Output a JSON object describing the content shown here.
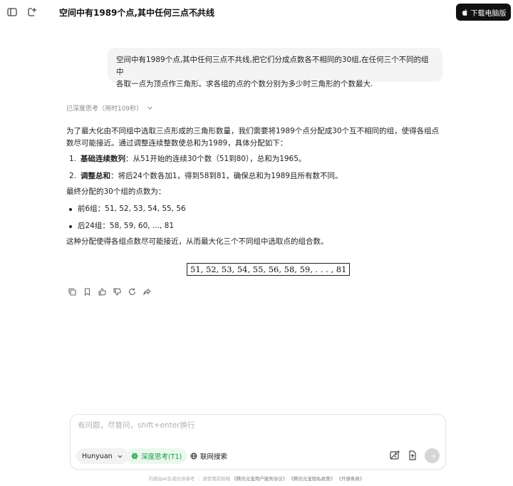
{
  "header": {
    "conversation_title": "空间中有1989个点,其中任何三点不共线",
    "download_label": "下载电脑版",
    "icons": [
      "sidebar-toggle-icon",
      "new-chat-icon",
      "chevron-down-icon",
      "apple-icon"
    ]
  },
  "user_message": {
    "line1": "空间中有1989个点,其中任何三点不共线,把它们分成点数各不相同的30组,在任何三个不同的组中",
    "line2": "各取一点为顶点作三角形。求各组的点的个数分别为多少时三角形的个数最大."
  },
  "thinking": {
    "label": "已深度思考（用时109秒）"
  },
  "answer": {
    "intro_line1": "为了最大化由不同组中选取三点形成的三角形数量，我们需要将1989个点分配成30个互不相同的组，使得各组点",
    "intro_line2": "数尽可能接近。通过调整连续整数使总和为1989，具体分配如下：",
    "steps": [
      {
        "num": "1.",
        "title": "基础连续数列",
        "text": "：从51开始的连续30个数（51到80），总和为1965。"
      },
      {
        "num": "2.",
        "title": "调整总和",
        "text": "：将后24个数各加1，得到58到81，确保总和为1989且所有数不同。"
      }
    ],
    "final_label": "最终分配的30个组的点数为：",
    "groups": [
      {
        "text": "前6组：51, 52, 53, 54, 55, 56"
      },
      {
        "text": "后24组：58, 59, 60, ..., 81"
      }
    ],
    "conclusion": "这种分配使得各组点数尽可能接近，从而最大化三个不同组中选取点的组合数。",
    "boxed_result": "51, 52, 53, 54, 55, 56, 58, 59, . . . , 81"
  },
  "message_actions": [
    "copy-icon",
    "bookmark-icon",
    "thumbs-up-icon",
    "thumbs-down-icon",
    "regenerate-icon",
    "share-icon"
  ],
  "composer": {
    "placeholder": "有问题，尽管问，shift+enter换行",
    "model_label": "Hunyuan",
    "deep_think_label": "深度思考(T1)",
    "web_search_label": "联网搜索",
    "accent_green": "#1a9b46"
  },
  "footer": {
    "disclaimer": "内容由AI生成仅供参考 ｜ 请使用前知晓",
    "link1": "《腾讯元宝用户服务协议》",
    "link2": "《腾讯元宝隐私政策》",
    "link3": "《开源条款》"
  }
}
